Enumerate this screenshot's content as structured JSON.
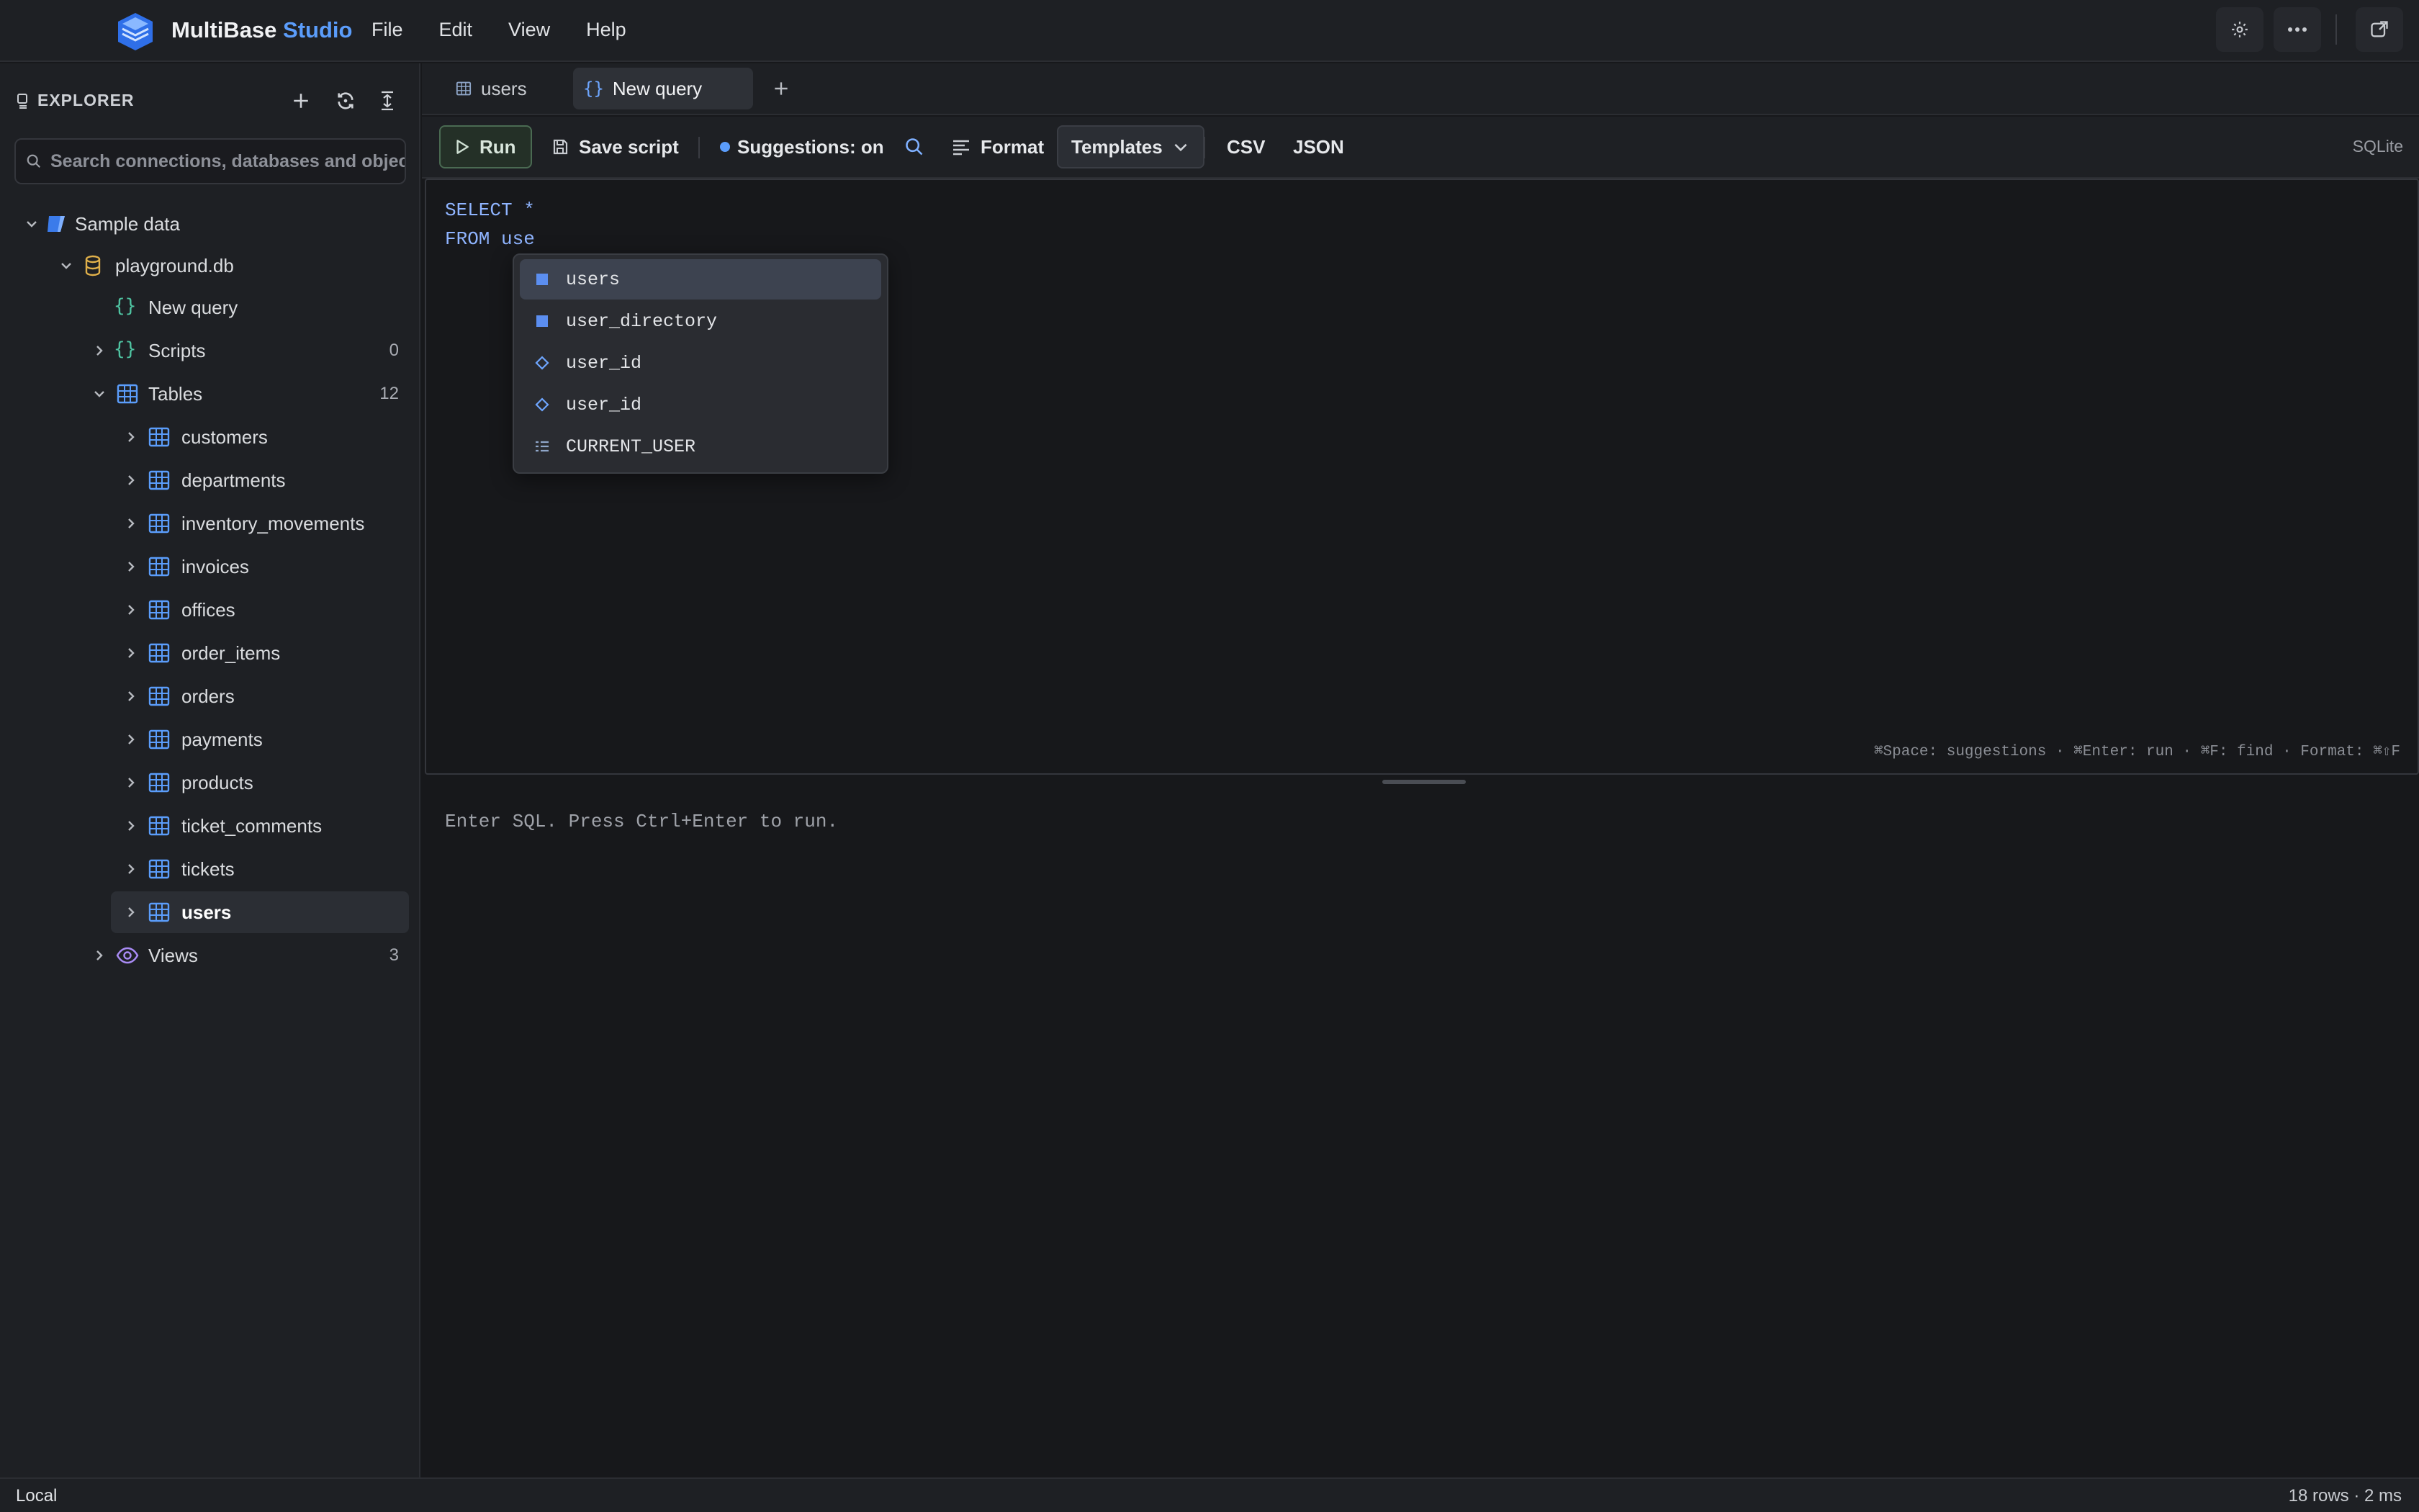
{
  "app": {
    "brand_main": "MultiBase",
    "brand_accent": "Studio",
    "menu": [
      "File",
      "Edit",
      "View",
      "Help"
    ]
  },
  "sidebar": {
    "title": "EXPLORER",
    "search_placeholder": "Search connections, databases and objects",
    "tree": {
      "connection": "Sample data",
      "database": "playground.db",
      "new_query": "New query",
      "scripts": {
        "label": "Scripts",
        "count": "0"
      },
      "tables": {
        "label": "Tables",
        "count": "12"
      },
      "table_items": [
        "customers",
        "departments",
        "inventory_movements",
        "invoices",
        "offices",
        "order_items",
        "orders",
        "payments",
        "products",
        "ticket_comments",
        "tickets",
        "users"
      ],
      "views": {
        "label": "Views",
        "count": "3"
      }
    }
  },
  "tabs": [
    {
      "label": "users",
      "icon": "table-icon"
    },
    {
      "label": "New query",
      "icon": "braces-icon"
    }
  ],
  "toolbar": {
    "run": "Run",
    "save": "Save script",
    "suggestions": "Suggestions: on",
    "format": "Format",
    "templates": "Templates",
    "csv": "CSV",
    "json": "JSON",
    "dialect": "SQLite"
  },
  "editor": {
    "line1_kw": "SELECT",
    "line1_rest": " *",
    "line2_kw": "FROM",
    "line2_rest": " use",
    "hints": "⌘Space: suggestions · ⌘Enter: run · ⌘F: find · Format: ⌘⇧F"
  },
  "autocomplete": [
    {
      "label": "users",
      "kind": "table",
      "active": true
    },
    {
      "label": "user_directory",
      "kind": "table",
      "active": false
    },
    {
      "label": "user_id",
      "kind": "column",
      "active": false
    },
    {
      "label": "user_id",
      "kind": "column",
      "active": false
    },
    {
      "label": "CURRENT_USER",
      "kind": "keyword",
      "active": false
    }
  ],
  "results": {
    "message": "Enter SQL. Press Ctrl+Enter to run."
  },
  "status": {
    "left": "Local",
    "right": "18 rows · 2 ms"
  },
  "colors": {
    "accent": "#5b9dfb",
    "table_icon": "#5b9dfb",
    "braces_icon": "#4fc3a1",
    "db_icon": "#e0b04a",
    "view_icon": "#a98bf5"
  }
}
